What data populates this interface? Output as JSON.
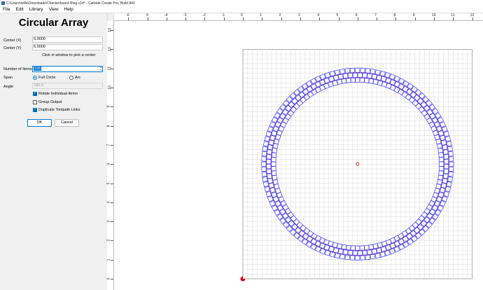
{
  "window": {
    "title": "C:\\Users\\willa\\Downloads\\Checkerboard Ring.c2d* - Carbide Create Pro, Build 843"
  },
  "menu": [
    "File",
    "Edit",
    "Library",
    "View",
    "Help"
  ],
  "panel": {
    "title": "Circular Array",
    "center_x": {
      "label": "Center (X)",
      "value": "6.0000"
    },
    "center_y": {
      "label": "Center (Y)",
      "value": "6.0000"
    },
    "pick_hint": "Click in window to pick a center",
    "num_items": {
      "label": "Number of Items",
      "value": "116"
    },
    "span": {
      "label": "Span",
      "options": [
        "Full Circle",
        "Arc"
      ],
      "selected": "Full Circle"
    },
    "angle": {
      "label": "Angle",
      "value": "180.0",
      "disabled": true
    },
    "checkboxes": [
      {
        "label": "Rotate Individual Items",
        "checked": true
      },
      {
        "label": "Group Output",
        "checked": false
      },
      {
        "label": "Duplicate Toolpath Links",
        "checked": true
      }
    ],
    "ok_label": "OK",
    "cancel_label": "Cancel"
  },
  "ruler": {
    "x_labels": [
      "-6",
      "-5",
      "-4",
      "-3",
      "-2",
      "-1",
      "0",
      "1",
      "2",
      "3",
      "4",
      "5",
      "6",
      "7",
      "8",
      "9",
      "10",
      "11",
      "12"
    ],
    "y_labels": [
      "13",
      "12",
      "11",
      "10",
      "9",
      "8",
      "7",
      "6",
      "5",
      "4",
      "3",
      "2",
      "1",
      "0"
    ]
  },
  "colors": {
    "accent": "#0078d7",
    "ring_outline": "#3a3aff",
    "center_marker": "#e00000",
    "grid": "#d9d9d9"
  }
}
